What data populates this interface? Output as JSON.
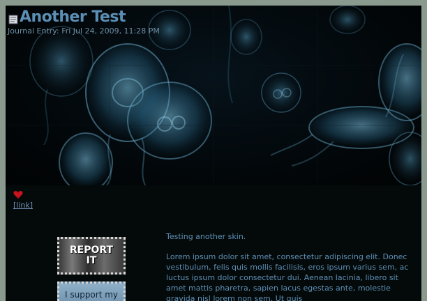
{
  "entry": {
    "title": "Another Test",
    "meta": "Journal Entry: Fri Jul 24, 2009, 11:28 PM"
  },
  "actions": {
    "link_label": "[link]"
  },
  "sidebar": {
    "report_label": "REPORT IT",
    "support_label": "I support my"
  },
  "content": {
    "intro": "Testing another skin.",
    "lorem": "Lorem ipsum dolor sit amet, consectetur adipiscing elit. Donec vestibulum, felis quis mollis facilisis, eros ipsum varius sem, ac luctus ipsum dolor consectetur dui. Aenean lacinia, libero sit amet mattis pharetra, sapien lacus egestas ante, molestie gravida nisl lorem non sem. Ut quis"
  },
  "icons": {
    "journal": "journal-icon",
    "heart": "heart-icon"
  },
  "colors": {
    "title": "#5c8fb5",
    "text": "#5f8fb5",
    "background": "#040a0a",
    "frame": "#8a9a8e"
  }
}
